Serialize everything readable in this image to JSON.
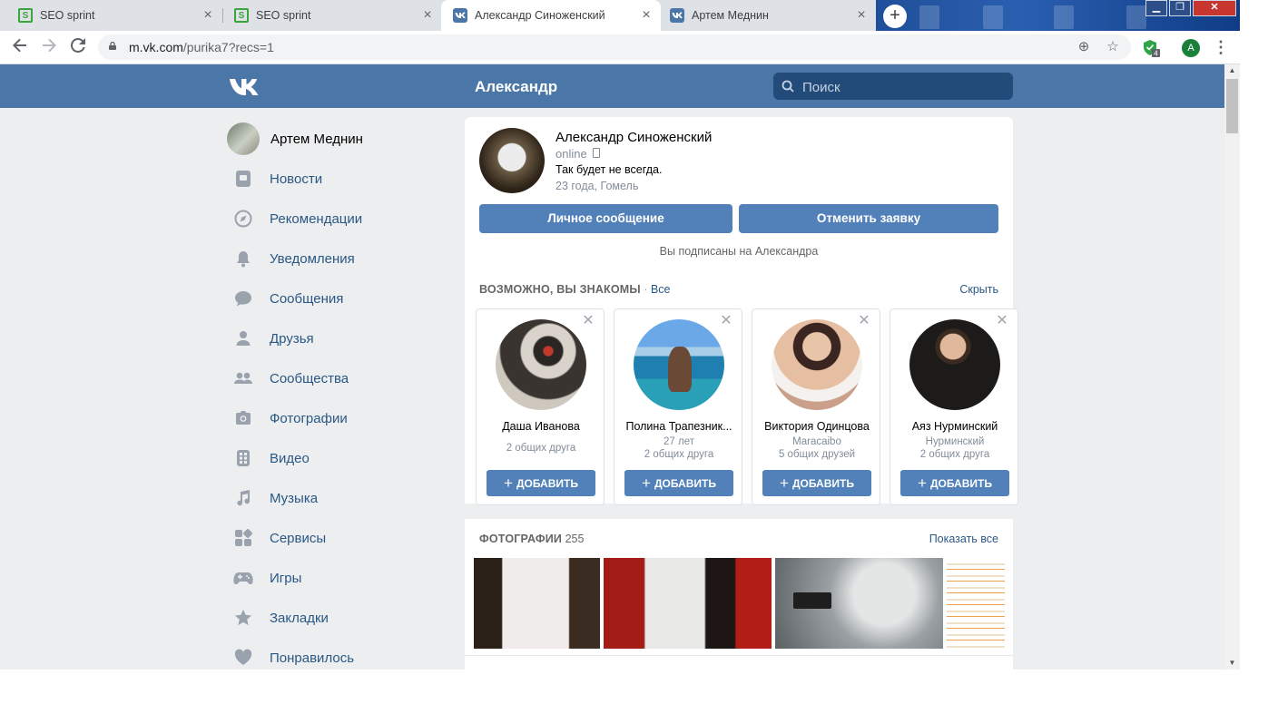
{
  "browser": {
    "tabs": [
      {
        "title": "SEO sprint",
        "favicon": "seo-sprint-icon",
        "active": false
      },
      {
        "title": "SEO sprint",
        "favicon": "seo-sprint-icon",
        "active": false
      },
      {
        "title": "Александр Синоженский",
        "favicon": "vk-icon",
        "active": true
      },
      {
        "title": "Артем Меднин",
        "favicon": "vk-icon",
        "active": false
      }
    ],
    "address": {
      "host": "m.vk.com",
      "path": "/purika7?recs=1"
    },
    "extension_badge": "4",
    "profile_initial": "A"
  },
  "vk": {
    "header_title": "Александр",
    "search_placeholder": "Поиск",
    "sidebar": {
      "user_name": "Артем Меднин",
      "items": [
        {
          "label": "Новости",
          "icon": "news-icon"
        },
        {
          "label": "Рекомендации",
          "icon": "compass-icon"
        },
        {
          "label": "Уведомления",
          "icon": "bell-icon"
        },
        {
          "label": "Сообщения",
          "icon": "message-icon"
        },
        {
          "label": "Друзья",
          "icon": "user-icon"
        },
        {
          "label": "Сообщества",
          "icon": "users-icon"
        },
        {
          "label": "Фотографии",
          "icon": "camera-icon"
        },
        {
          "label": "Видео",
          "icon": "video-icon"
        },
        {
          "label": "Музыка",
          "icon": "music-icon"
        },
        {
          "label": "Сервисы",
          "icon": "services-icon"
        },
        {
          "label": "Игры",
          "icon": "gamepad-icon"
        },
        {
          "label": "Закладки",
          "icon": "star-icon"
        },
        {
          "label": "Понравилось",
          "icon": "heart-icon"
        }
      ]
    },
    "profile": {
      "name": "Александр Синоженский",
      "online": "online",
      "status": "Так будет не всегда.",
      "info": "23 года, Гомель",
      "message_button": "Личное сообщение",
      "cancel_button": "Отменить заявку",
      "subscribed_note": "Вы подписаны на Александра"
    },
    "suggestions": {
      "title": "ВОЗМОЖНО, ВЫ ЗНАКОМЫ",
      "all_link": "Все",
      "hide_link": "Скрыть",
      "add_label": "ДОБАВИТЬ",
      "people": [
        {
          "name": "Даша Иванова",
          "line1": "2 общих друга",
          "line2": ""
        },
        {
          "name": "Полина Трапезник...",
          "line1": "27 лет",
          "line2": "2 общих друга"
        },
        {
          "name": "Виктория Одинцова",
          "line1": "Maracaibo",
          "line2": "5 общих друзей"
        },
        {
          "name": "Аяз Нурминский",
          "line1": "Нурминский",
          "line2": "2 общих друга"
        }
      ]
    },
    "photos": {
      "title": "ФОТОГРАФИИ",
      "count": "255",
      "show_all": "Показать все"
    }
  }
}
